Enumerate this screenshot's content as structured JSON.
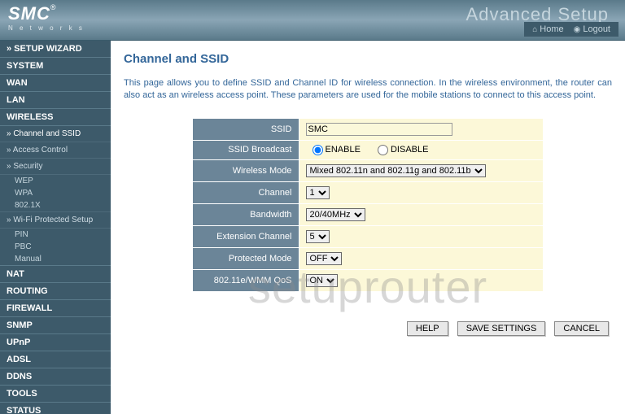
{
  "header": {
    "logo": "SMC",
    "logo_sub": "N e t w o r k s",
    "title": "Advanced Setup",
    "home": "Home",
    "logout": "Logout"
  },
  "nav": {
    "wizard": "» SETUP WIZARD",
    "system": "SYSTEM",
    "wan": "WAN",
    "lan": "LAN",
    "wireless": "WIRELESS",
    "channel_ssid": "» Channel and SSID",
    "access_control": "» Access Control",
    "security": "» Security",
    "wep": "WEP",
    "wpa": "WPA",
    "x8021": "802.1X",
    "wps": "» Wi-Fi Protected Setup",
    "pin": "PIN",
    "pbc": "PBC",
    "manual": "Manual",
    "nat": "NAT",
    "routing": "ROUTING",
    "firewall": "FIREWALL",
    "snmp": "SNMP",
    "upnp": "UPnP",
    "adsl": "ADSL",
    "ddns": "DDNS",
    "tools": "TOOLS",
    "status": "STATUS"
  },
  "page": {
    "title": "Channel and SSID",
    "desc": "This page allows you to define SSID and Channel ID for wireless connection.  In the wireless environment, the router can also act as an wireless access point.  These parameters are used for the mobile stations to connect to this access point."
  },
  "form": {
    "ssid_label": "SSID",
    "ssid_value": "SMC",
    "broadcast_label": "SSID Broadcast",
    "enable": "ENABLE",
    "disable": "DISABLE",
    "mode_label": "Wireless Mode",
    "mode_value": "Mixed 802.11n and 802.11g and 802.11b",
    "channel_label": "Channel",
    "channel_value": "1",
    "bandwidth_label": "Bandwidth",
    "bandwidth_value": "20/40MHz",
    "ext_label": "Extension Channel",
    "ext_value": "5",
    "protected_label": "Protected Mode",
    "protected_value": "OFF",
    "wmm_label": "802.11e/WMM QoS",
    "wmm_value": "ON"
  },
  "buttons": {
    "help": "HELP",
    "save": "SAVE SETTINGS",
    "cancel": "CANCEL"
  },
  "watermark": "setuprouter"
}
